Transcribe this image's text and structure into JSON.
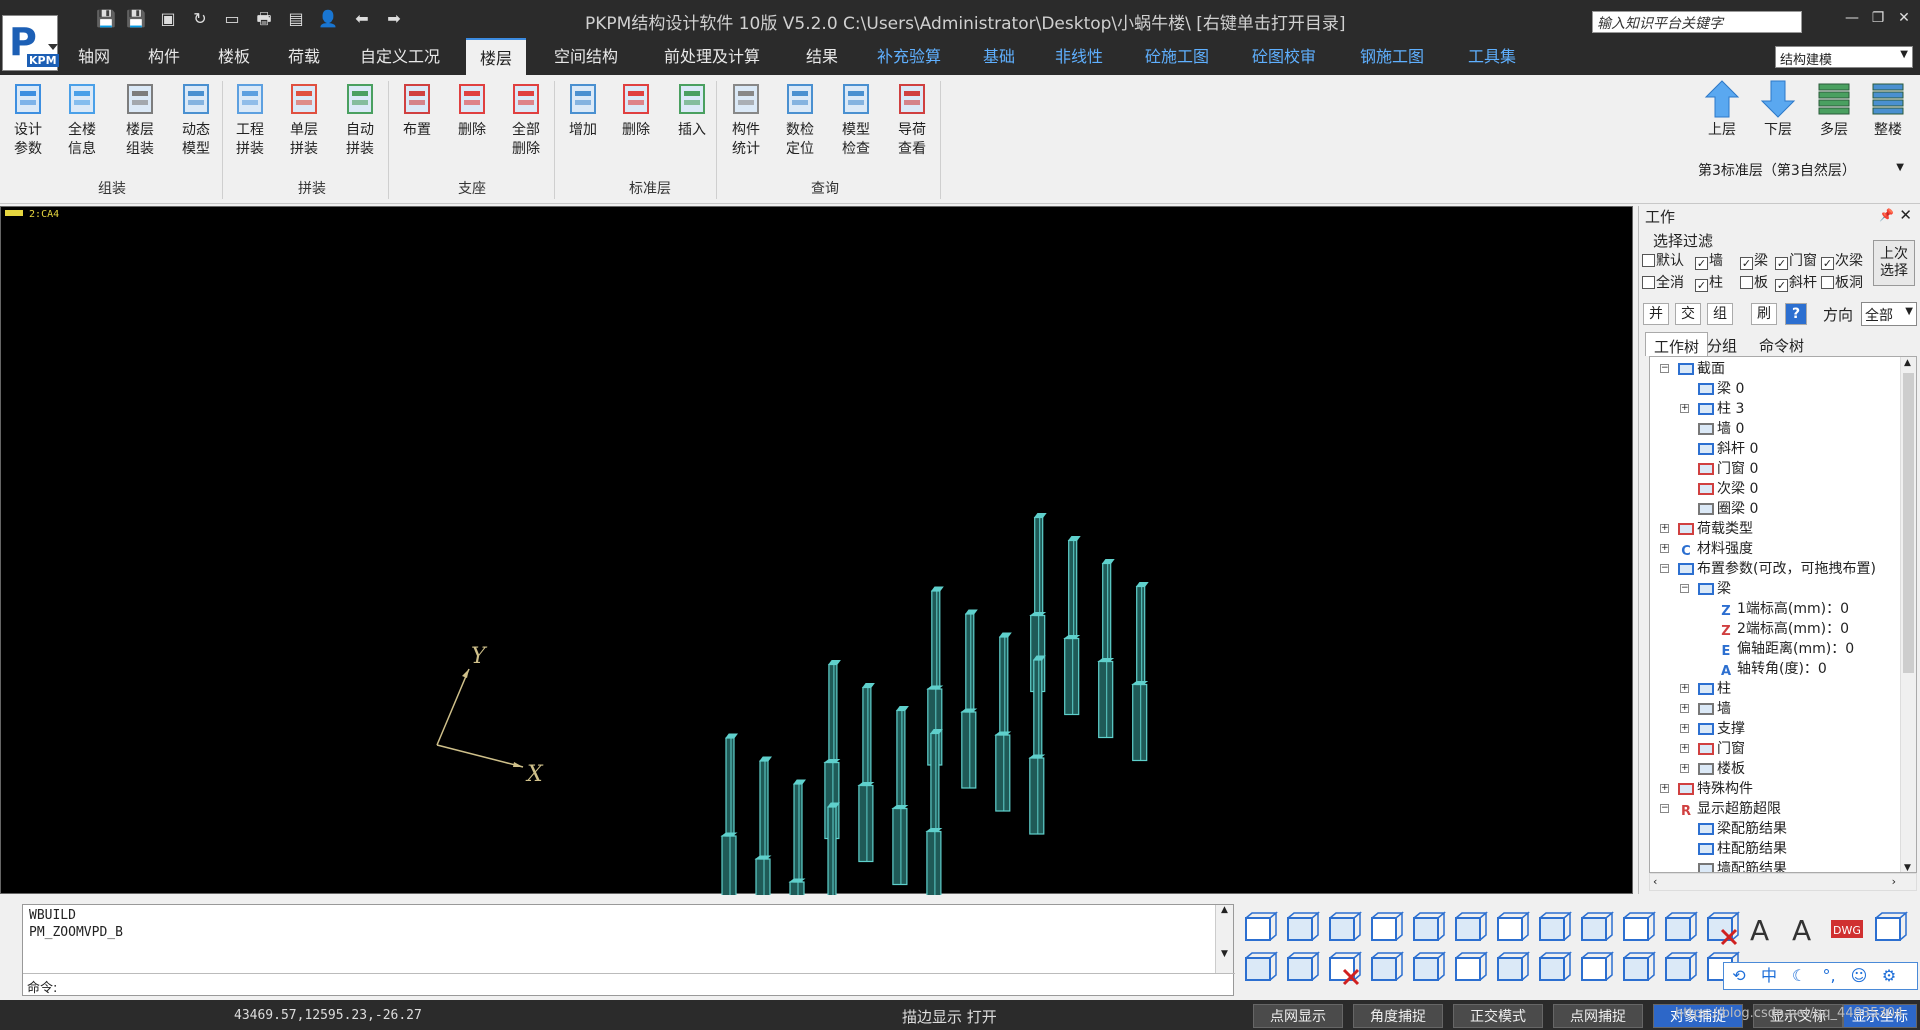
{
  "title_bar": {
    "app_title": "PKPM结构设计软件 10版 V5.2.0 C:\\Users\\Administrator\\Desktop\\小蜗牛楼\\  [右键单击打开目录]",
    "logo_text": "P",
    "logo_sub": "KPM",
    "search_placeholder": "输入知识平台关键字",
    "quick_icons": [
      "save-icon",
      "save-as-icon",
      "save-all-icon",
      "refresh-icon",
      "drawing-icon",
      "print-icon",
      "document-icon",
      "user-icon",
      "undo-arrow-icon",
      "redo-arrow-icon"
    ]
  },
  "menu": {
    "tabs": [
      {
        "label": "轴网"
      },
      {
        "label": "构件"
      },
      {
        "label": "楼板"
      },
      {
        "label": "荷载"
      },
      {
        "label": "自定义工况"
      },
      {
        "label": "楼层"
      },
      {
        "label": "空间结构"
      },
      {
        "label": "前处理及计算"
      },
      {
        "label": "结果"
      },
      {
        "label": "补充验算"
      },
      {
        "label": "基础"
      },
      {
        "label": "非线性"
      },
      {
        "label": "砼施工图"
      },
      {
        "label": "砼图校审"
      },
      {
        "label": "钢施工图"
      },
      {
        "label": "工具集"
      }
    ],
    "active_tab": "楼层",
    "mode_select": "结构建模"
  },
  "ribbon": {
    "buttons": [
      {
        "l1": "设计",
        "l2": "参数"
      },
      {
        "l1": "全楼",
        "l2": "信息"
      },
      {
        "l1": "楼层",
        "l2": "组装"
      },
      {
        "l1": "动态",
        "l2": "模型"
      },
      {
        "l1": "工程",
        "l2": "拼装"
      },
      {
        "l1": "单层",
        "l2": "拼装"
      },
      {
        "l1": "自动",
        "l2": "拼装"
      },
      {
        "l1": "布置",
        "l2": ""
      },
      {
        "l1": "删除",
        "l2": ""
      },
      {
        "l1": "全部",
        "l2": "删除"
      },
      {
        "l1": "增加",
        "l2": ""
      },
      {
        "l1": "删除",
        "l2": ""
      },
      {
        "l1": "插入",
        "l2": ""
      },
      {
        "l1": "构件",
        "l2": "统计"
      },
      {
        "l1": "数检",
        "l2": "定位"
      },
      {
        "l1": "模型",
        "l2": "检查"
      },
      {
        "l1": "导荷",
        "l2": "查看"
      }
    ],
    "groups": [
      "组装",
      "拼装",
      "支座",
      "标准层",
      "查询"
    ],
    "floor_nav": [
      {
        "label": "上层"
      },
      {
        "label": "下层"
      },
      {
        "label": "多层"
      },
      {
        "label": "整楼"
      }
    ],
    "floor_select": "第3标准层（第3自然层）"
  },
  "viewport": {
    "tag": "2:CA4",
    "axis_x": "X",
    "axis_y": "Y",
    "background": "#000000",
    "column_color": "#5fd0cc"
  },
  "work_panel": {
    "title": "工作",
    "filter_label": "选择过滤",
    "checkboxes": [
      {
        "label": "默认",
        "checked": false
      },
      {
        "label": "墙",
        "checked": true
      },
      {
        "label": "梁",
        "checked": true
      },
      {
        "label": "门窗",
        "checked": true
      },
      {
        "label": "次梁",
        "checked": true
      },
      {
        "label": "全消",
        "checked": false
      },
      {
        "label": "柱",
        "checked": true
      },
      {
        "label": "板",
        "checked": false
      },
      {
        "label": "斜杆",
        "checked": true
      },
      {
        "label": "板洞",
        "checked": false
      }
    ],
    "last_select_l1": "上次",
    "last_select_l2": "选择",
    "tools": [
      "并",
      "交",
      "组",
      "刷",
      "?"
    ],
    "direction_label": "方向",
    "direction_value": "全部",
    "tabs": [
      "工作树",
      "分组",
      "命令树"
    ],
    "tree": [
      {
        "label": "截面",
        "level": 0,
        "exp": "−",
        "icon": "section-icon"
      },
      {
        "label": "梁 0",
        "level": 1,
        "exp": "",
        "icon": "beam-icon"
      },
      {
        "label": "柱 3",
        "level": 1,
        "exp": "+",
        "icon": "column-icon"
      },
      {
        "label": "墙 0",
        "level": 1,
        "exp": "",
        "icon": "wall-icon"
      },
      {
        "label": "斜杆 0",
        "level": 1,
        "exp": "",
        "icon": "brace-icon"
      },
      {
        "label": "门窗 0",
        "level": 1,
        "exp": "",
        "icon": "door-window-icon"
      },
      {
        "label": "次梁 0",
        "level": 1,
        "exp": "",
        "icon": "secondary-beam-icon"
      },
      {
        "label": "圈梁 0",
        "level": 1,
        "exp": "",
        "icon": "ring-beam-icon"
      },
      {
        "label": "荷载类型",
        "level": 0,
        "exp": "+",
        "icon": "load-type-icon"
      },
      {
        "label": "材料强度",
        "level": 0,
        "exp": "+",
        "icon": "material-icon"
      },
      {
        "label": "布置参数(可改，可拖拽布置)",
        "level": 0,
        "exp": "−",
        "icon": "layout-param-icon"
      },
      {
        "label": "梁",
        "level": 1,
        "exp": "−",
        "icon": "beam-icon"
      },
      {
        "label": "1端标高(mm)：0",
        "level": 2,
        "exp": "",
        "icon": "z1-icon"
      },
      {
        "label": "2端标高(mm)：0",
        "level": 2,
        "exp": "",
        "icon": "z2-icon"
      },
      {
        "label": "偏轴距离(mm)：0",
        "level": 2,
        "exp": "",
        "icon": "ec-icon"
      },
      {
        "label": "轴转角(度)：0",
        "level": 2,
        "exp": "",
        "icon": "angle-icon"
      },
      {
        "label": "柱",
        "level": 1,
        "exp": "+",
        "icon": "column-icon"
      },
      {
        "label": "墙",
        "level": 1,
        "exp": "+",
        "icon": "wall-icon"
      },
      {
        "label": "支撑",
        "level": 1,
        "exp": "+",
        "icon": "brace-icon"
      },
      {
        "label": "门窗",
        "level": 1,
        "exp": "+",
        "icon": "door-window-icon"
      },
      {
        "label": "楼板",
        "level": 1,
        "exp": "+",
        "icon": "slab-icon"
      },
      {
        "label": "特殊构件",
        "level": 0,
        "exp": "+",
        "icon": "special-member-icon"
      },
      {
        "label": "显示超筋超限",
        "level": 0,
        "exp": "−",
        "icon": "r-icon"
      },
      {
        "label": "梁配筋结果",
        "level": 1,
        "exp": "",
        "icon": "beam-icon"
      },
      {
        "label": "柱配筋结果",
        "level": 1,
        "exp": "",
        "icon": "column-icon"
      },
      {
        "label": "墙配筋结果",
        "level": 1,
        "exp": "",
        "icon": "wall-icon"
      }
    ]
  },
  "command": {
    "log": [
      "WBUILD",
      "PM_ZOOMVPD_B"
    ],
    "prompt": "命令:",
    "input_value": ""
  },
  "status": {
    "coords": "43469.57,12595.23,-26.27",
    "outline": "描边显示 打开",
    "toggles": [
      {
        "label": "点网显示",
        "on": false
      },
      {
        "label": "角度捕捉",
        "on": false
      },
      {
        "label": "正交模式",
        "on": false
      },
      {
        "label": "点网捕捉",
        "on": false
      },
      {
        "label": "对象捕捉",
        "on": true
      },
      {
        "label": "显示叉标",
        "on": false
      },
      {
        "label": "显示坐标",
        "on": true
      }
    ],
    "watermark": "https://blog.csdn.net/qq_44035304"
  },
  "ime": [
    "中",
    "☾",
    "°,",
    "☺",
    "⚙"
  ]
}
